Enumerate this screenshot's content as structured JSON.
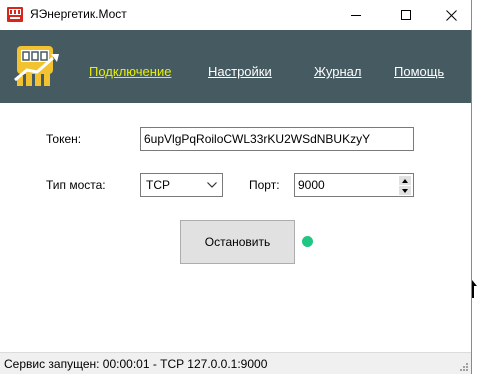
{
  "window": {
    "title": "ЯЭнергетик.Мост",
    "controls": {
      "minimize": "minimize-icon",
      "maximize": "maximize-icon",
      "close": "close-icon"
    }
  },
  "header": {
    "background": "#455a61",
    "nav": [
      {
        "label": "Подключение",
        "active": true
      },
      {
        "label": "Настройки",
        "active": false
      },
      {
        "label": "Журнал",
        "active": false
      },
      {
        "label": "Помощь",
        "active": false
      }
    ],
    "active_color": "#e8f000"
  },
  "form": {
    "token_label": "Токен:",
    "token_value": "6upVlgPqRoiloCWL33rKU2WSdNBUKzyY",
    "bridge_label": "Тип моста:",
    "bridge_value": "TCP",
    "port_label": "Порт:",
    "port_value": "9000"
  },
  "actions": {
    "stop_label": "Остановить",
    "status_indicator_color": "#1ec882"
  },
  "statusbar": {
    "text": "Сервис запущен: 00:00:01 - TCP 127.0.0.1:9000"
  }
}
